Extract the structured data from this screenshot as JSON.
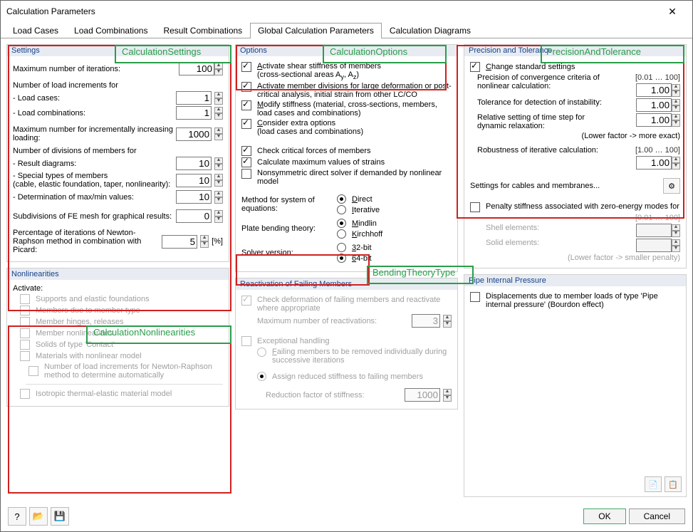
{
  "window": {
    "title": "Calculation Parameters"
  },
  "tabs": {
    "load_cases": "Load Cases",
    "load_combinations": "Load Combinations",
    "result_combinations": "Result Combinations",
    "global": "Global Calculation Parameters",
    "diagrams": "Calculation Diagrams"
  },
  "settings": {
    "header": "Settings",
    "max_iter_label": "Maximum number of iterations:",
    "max_iter_val": "100",
    "nli_label": "Number of load increments for",
    "nli_load_cases_label": "- Load cases:",
    "nli_load_cases_val": "1",
    "nli_load_comb_label": "- Load combinations:",
    "nli_load_comb_val": "1",
    "max_inc_loading_label": "Maximum number for incrementally increasing loading:",
    "max_inc_loading_val": "1000",
    "ndm_label": "Number of divisions of members for",
    "ndm_result_label": "- Result diagrams:",
    "ndm_result_val": "10",
    "ndm_special_label": "- Special types of members\n  (cable, elastic foundation, taper, nonlinearity):",
    "ndm_special_val": "10",
    "ndm_maxmin_label": "- Determination of max/min values:",
    "ndm_maxmin_val": "10",
    "subdiv_label": "Subdivisions of FE mesh for graphical results:",
    "subdiv_val": "0",
    "picard_label": "Percentage of iterations of Newton-Raphson method in combination with Picard:",
    "picard_val": "5",
    "picard_unit": "[%]"
  },
  "nonlin": {
    "header": "Nonlinearities",
    "activate": "Activate:",
    "supp": "Supports and elastic foundations",
    "memtype": "Members due to member type",
    "hinges": "Member hinges, releases",
    "memnl": "Member nonlinearities",
    "solids": "Solids of type 'Contact'",
    "materials": "Materials with nonlinear model",
    "nr_incr": "Number of load increments for Newton-Raphson method to determine automatically",
    "iso": "Isotropic thermal-elastic material model"
  },
  "options": {
    "header": "Options",
    "shear1": "Activate shear stiffness of members",
    "shear2": "(cross-sectional areas A",
    "shear2b": ", A",
    "shear2c": ")",
    "sub_y": "y",
    "sub_z": "z",
    "divs": "Activate member divisions for large deformation or post-critical analysis, initial strain from other LC/CO",
    "modstiff": "Modify stiffness (material, cross-sections, members, load cases and combinations)",
    "extra": "Consider extra options\n(load cases and combinations)",
    "critical": "Check critical forces of members",
    "strains": "Calculate maximum values of strains",
    "nonsym": "Nonsymmetric direct solver if demanded by nonlinear model",
    "method_label": "Method for system of equations:",
    "method_direct": "Direct",
    "method_iter": "Iterative",
    "plate_label": "Plate bending theory:",
    "plate_mindlin": "Mindlin",
    "plate_kirch": "Kirchhoff",
    "solver_label": "Solver version:",
    "solver_32": "32-bit",
    "solver_64": "64-bit"
  },
  "react": {
    "header": "Reactivation of Failing Members",
    "check": "Check deformation of failing members and reactivate where appropriate",
    "maxreact": "Maximum number of reactivations:",
    "maxreact_val": "3",
    "except": "Exceptional handling",
    "opt1": "Failing members to be removed individually during successive iterations",
    "opt2": "Assign reduced stiffness to failing members",
    "redf": "Reduction factor of stiffness:",
    "redf_val": "1000"
  },
  "prec": {
    "header": "Precision and Tolerance",
    "change": "Change standard settings",
    "conv_label": "Precision of convergence criteria of nonlinear calculation:",
    "conv_range": "[0.01 … 100]",
    "conv_val": "1.00",
    "tol_label": "Tolerance for detection of instability:",
    "tol_val": "1.00",
    "ts_label": "Relative setting of time step for dynamic relaxation:",
    "ts_val": "1.00",
    "ts_note": "(Lower factor -> more exact)",
    "rob_label": "Robustness of iterative calculation:",
    "rob_range": "[1.00 … 100]",
    "rob_val": "1.00",
    "cables_label": "Settings for cables and membranes...",
    "penalty": "Penalty stiffness associated with zero-energy modes for",
    "penalty_range": "[0.01 … 100]",
    "penalty_note": "(Lower factor -> smaller penalty)",
    "shell_label": "Shell elements:",
    "solid_label": "Solid elements:"
  },
  "pipe": {
    "header": "Pipe Internal Pressure",
    "disp": "Displacements due to member loads of type 'Pipe internal pressure' (Bourdon effect)"
  },
  "footer": {
    "ok": "OK",
    "cancel": "Cancel"
  },
  "annotations": {
    "calc_settings": "CalculationSettings",
    "calc_options": "CalculationOptions",
    "prec_tol": "PrecisionAndTolerance",
    "calc_nonlin": "CalculationNonlinearities",
    "bending": "BendingTheoryType"
  }
}
